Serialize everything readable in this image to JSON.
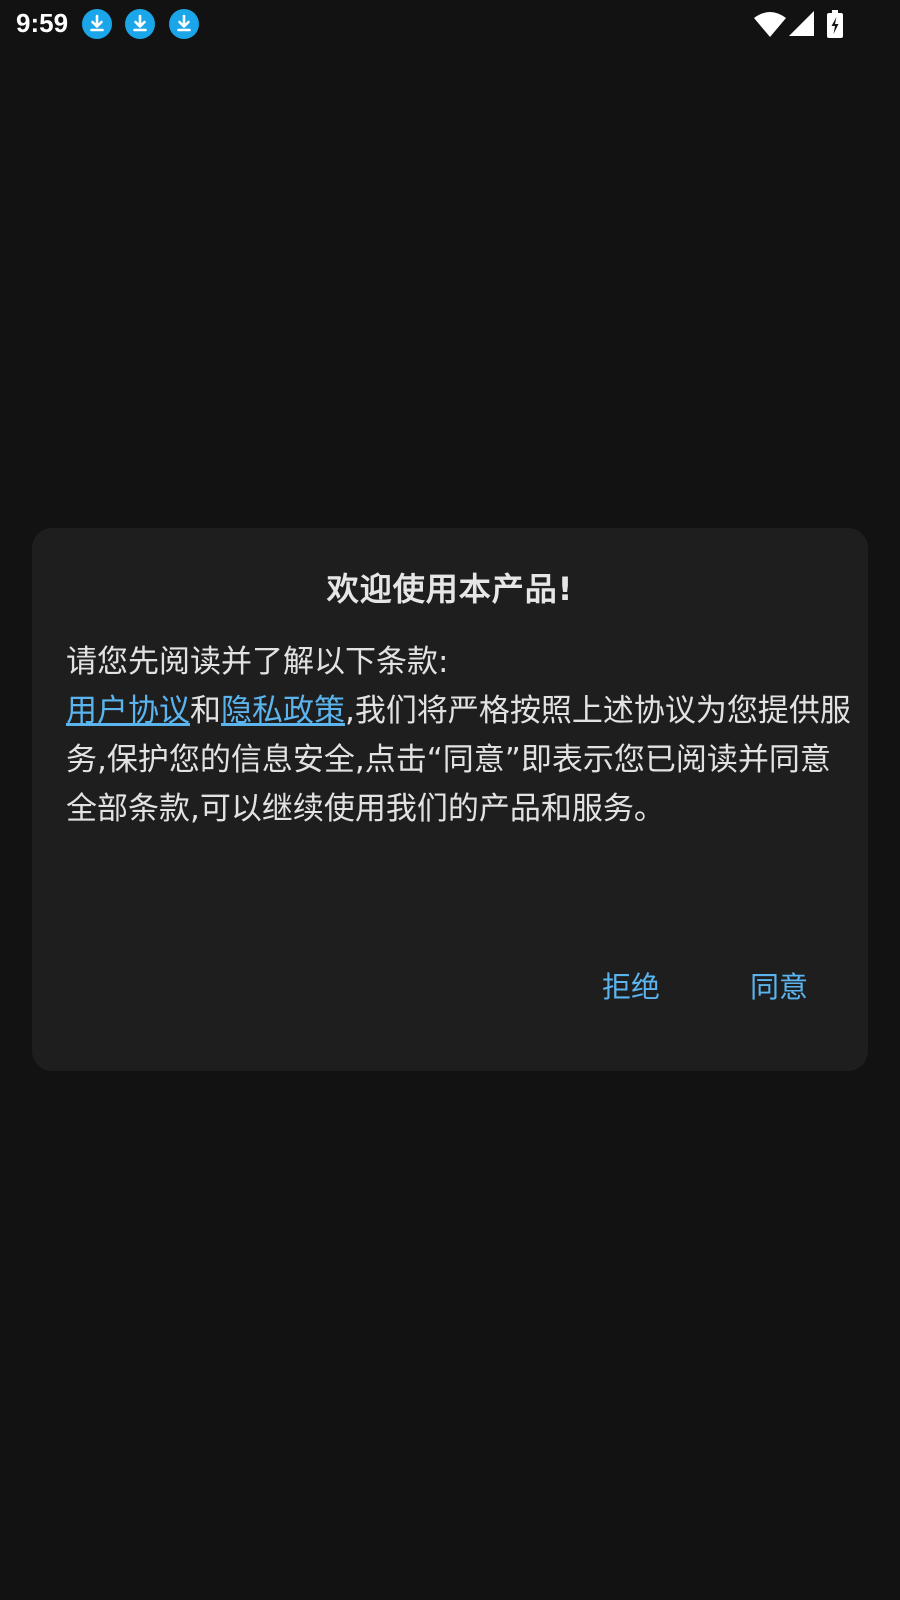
{
  "status_bar": {
    "time": "9:59",
    "notification_icons": [
      "download-icon",
      "download-icon",
      "download-icon"
    ],
    "system_icons": [
      "wifi-icon",
      "signal-icon",
      "battery-charging-icon"
    ],
    "notification_color": "#1aa6e8"
  },
  "dialog": {
    "title": "欢迎使用本产品!",
    "intro": "请您先阅读并了解以下条款:",
    "user_agreement_link": "用户协议",
    "and_text": "和",
    "privacy_policy_link": "隐私政策",
    "body_rest": ",我们将严格按照上述协议为您提供服务,保护您的信息安全,点击“同意”即表示您已阅读并同意全部条款,可以继续使用我们的产品和服务。",
    "reject_label": "拒绝",
    "agree_label": "同意",
    "accent_color": "#5bb4ee"
  }
}
